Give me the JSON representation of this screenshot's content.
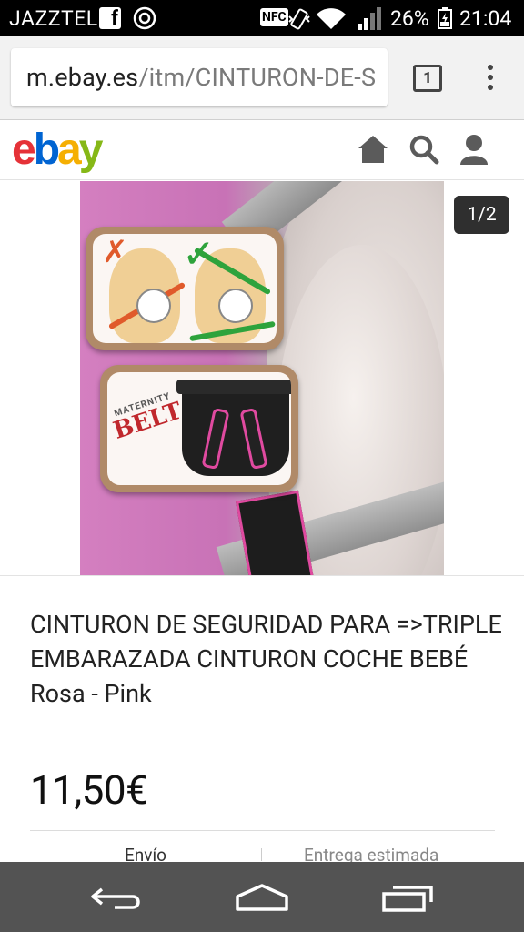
{
  "status_bar": {
    "carrier": "JAZZTEL",
    "nfc_label": "NFC",
    "battery_percent": "26%",
    "time": "21:04"
  },
  "browser": {
    "url_host": "m.ebay.es",
    "url_path": "/itm/CINTURON-DE-S",
    "tab_count": "1"
  },
  "brand": {
    "logo_letters": [
      "e",
      "b",
      "a",
      "y"
    ],
    "logo_colors": [
      "#e53238",
      "#0064d2",
      "#f5af02",
      "#86b817"
    ]
  },
  "header_icons": [
    "home-icon",
    "search-icon",
    "user-icon"
  ],
  "gallery": {
    "image_counter": "1/2",
    "image_labels": {
      "belt_small": "MATERNITY",
      "belt_big": "BELT"
    }
  },
  "listing": {
    "title": "CINTURON DE SEGURIDAD PARA =>TRIPLE EMBARAZADA CINTURON COCHE BEBÉ Rosa - Pink",
    "price": "11,50€"
  },
  "info_tabs": {
    "shipping": "Envío",
    "delivery": "Entrega estimada"
  },
  "nav_icons": [
    "back-icon",
    "home-icon",
    "recents-icon"
  ],
  "colors": {
    "status_bar_bg": "#000000",
    "browser_bar_bg": "#f2f2f2",
    "nav_bar_bg": "#535353",
    "counter_bg": "#2f2f2f"
  }
}
